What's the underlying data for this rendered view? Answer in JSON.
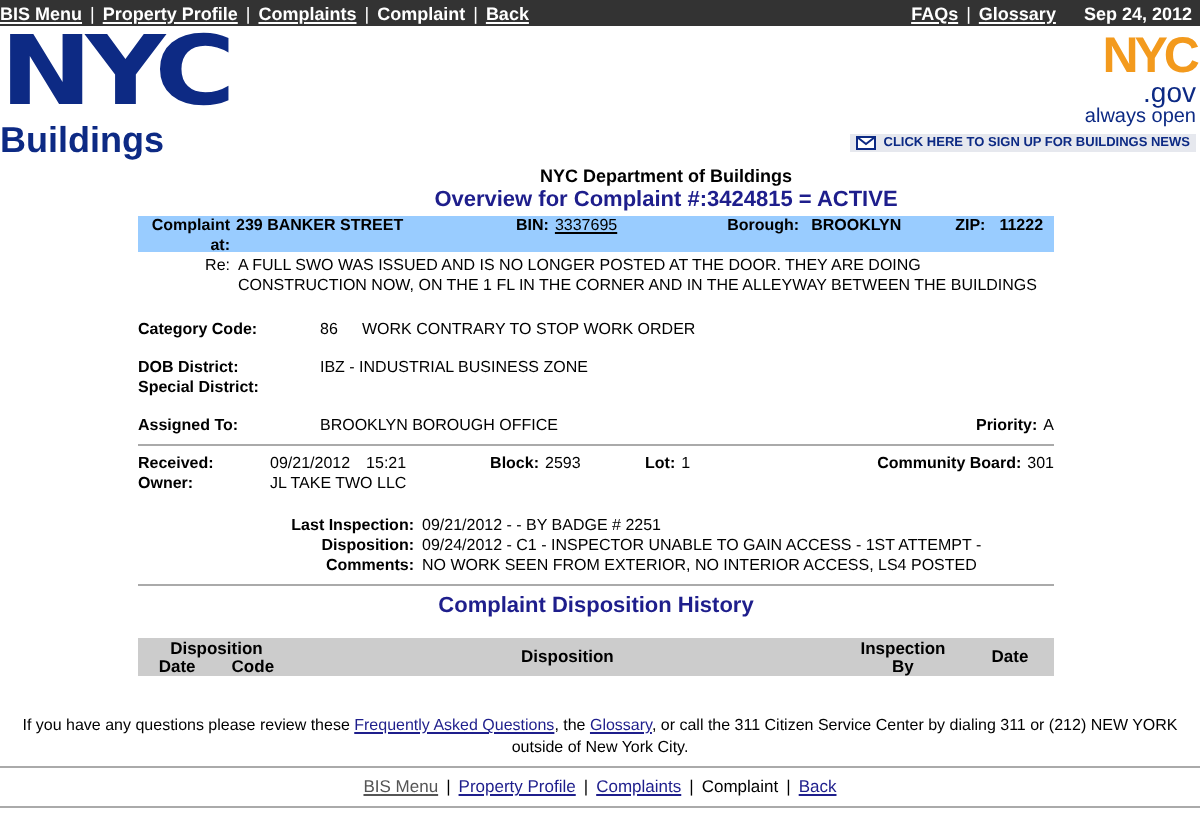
{
  "top_nav": {
    "left": [
      {
        "label": "BIS Menu",
        "kind": "link"
      },
      {
        "label": "|",
        "kind": "separator"
      },
      {
        "label": "Property Profile",
        "kind": "link"
      },
      {
        "label": "|",
        "kind": "separator"
      },
      {
        "label": "Complaints",
        "kind": "link"
      },
      {
        "label": "|",
        "kind": "separator"
      },
      {
        "label": "Complaint",
        "kind": "current"
      },
      {
        "label": "|",
        "kind": "separator"
      },
      {
        "label": "Back",
        "kind": "link"
      }
    ],
    "right": [
      {
        "label": "FAQs",
        "kind": "link"
      },
      {
        "label": "|",
        "kind": "separator"
      },
      {
        "label": "Glossary",
        "kind": "link"
      }
    ],
    "date": "Sep 24, 2012"
  },
  "header": {
    "logo": {
      "mark": "NYC",
      "name": "Buildings"
    },
    "gov_logo": {
      "mark": "NYC",
      "suffix": ".gov",
      "tagline": "always open"
    },
    "news_button": "CLICK HERE TO SIGN UP FOR BUILDINGS NEWS"
  },
  "agency": "NYC Department of Buildings",
  "title": "Overview for Complaint #:3424815 = ACTIVE",
  "complaint_band": {
    "label": "Complaint at:",
    "address": "239 BANKER STREET",
    "bin_label": "BIN:",
    "bin": "3337695",
    "borough_label": "Borough:",
    "borough": "BROOKLYN",
    "zip_label": "ZIP:",
    "zip": "11222"
  },
  "re": {
    "label": "Re:",
    "text": "A FULL SWO WAS ISSUED AND IS NO LONGER POSTED AT THE DOOR. THEY ARE DOING CONSTRUCTION NOW, ON THE 1 FL IN THE CORNER AND IN THE ALLEYWAY BETWEEN THE BUILDINGS"
  },
  "category": {
    "label": "Category Code:",
    "code": "86",
    "description": "WORK CONTRARY TO STOP WORK ORDER"
  },
  "dob_district": {
    "label": "DOB District:",
    "value": "IBZ - INDUSTRIAL BUSINESS ZONE"
  },
  "special_district": {
    "label": "Special District:"
  },
  "assigned": {
    "label": "Assigned To:",
    "value": "BROOKLYN BOROUGH OFFICE",
    "priority_label": "Priority:",
    "priority": "A"
  },
  "received": {
    "label": "Received:",
    "date": "09/21/2012",
    "time": "15:21",
    "block_label": "Block:",
    "block": "2593",
    "lot_label": "Lot:",
    "lot": "1",
    "board_label": "Community Board:",
    "board": "301"
  },
  "owner": {
    "label": "Owner:",
    "value": "JL TAKE TWO LLC"
  },
  "inspection": [
    {
      "label": "Last Inspection:",
      "value": "09/21/2012 - - BY BADGE # 2251"
    },
    {
      "label": "Disposition:",
      "value": "09/24/2012 - C1 - INSPECTOR UNABLE TO GAIN ACCESS - 1ST ATTEMPT -"
    },
    {
      "label": "Comments:",
      "value": "NO WORK SEEN FROM EXTERIOR, NO INTERIOR ACCESS, LS4 POSTED"
    }
  ],
  "history": {
    "title": "Complaint Disposition History",
    "group": "Disposition",
    "group_columns": [
      "Date",
      "Code"
    ],
    "columns": [
      "Disposition",
      "Inspection By",
      "Date"
    ]
  },
  "footer": {
    "help_text": [
      {
        "kind": "text",
        "text": "If you have any questions please review these "
      },
      {
        "kind": "link",
        "text": "Frequently Asked Questions"
      },
      {
        "kind": "text",
        "text": ", the "
      },
      {
        "kind": "link",
        "text": "Glossary"
      },
      {
        "kind": "text",
        "text": ", or call the 311 Citizen Service Center by dialing 311 or (212) NEW YORK outside of New York City."
      }
    ]
  },
  "bottom_nav": [
    {
      "label": "BIS Menu",
      "kind": "link",
      "visited": true
    },
    {
      "label": "|",
      "kind": "separator"
    },
    {
      "label": "Property Profile",
      "kind": "link",
      "visited": false
    },
    {
      "label": "|",
      "kind": "separator"
    },
    {
      "label": "Complaints",
      "kind": "link",
      "visited": false
    },
    {
      "label": "|",
      "kind": "separator"
    },
    {
      "label": "Complaint",
      "kind": "current"
    },
    {
      "label": "|",
      "kind": "separator"
    },
    {
      "label": "Back",
      "kind": "link",
      "visited": false
    }
  ]
}
